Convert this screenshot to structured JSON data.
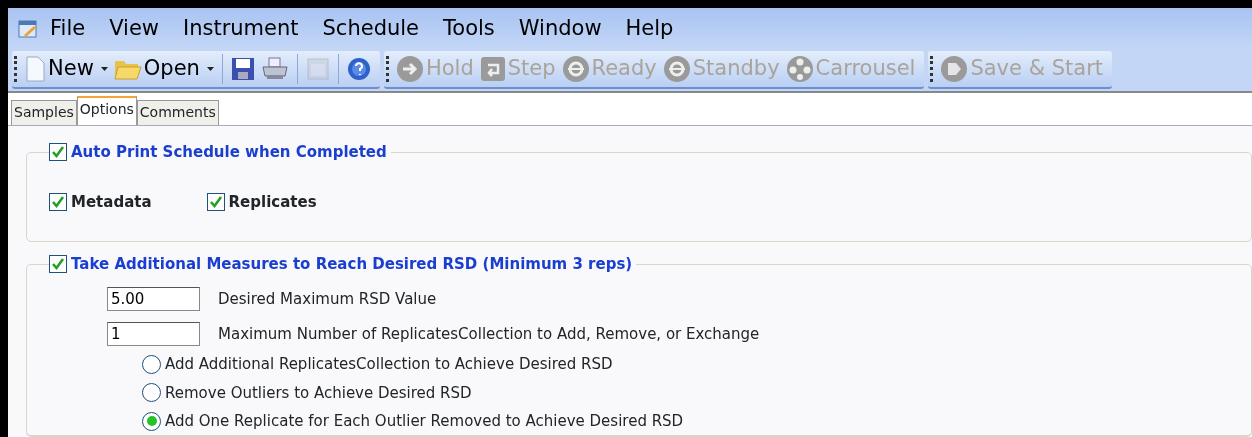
{
  "menu": [
    {
      "label": "File"
    },
    {
      "label": "View"
    },
    {
      "label": "Instrument"
    },
    {
      "label": "Schedule"
    },
    {
      "label": "Tools"
    },
    {
      "label": "Window"
    },
    {
      "label": "Help"
    }
  ],
  "toolbar": [
    {
      "items": [
        {
          "kind": "new",
          "label": "New",
          "dropdown": true,
          "disabled": false
        },
        {
          "kind": "open",
          "label": "Open",
          "dropdown": true,
          "disabled": false
        },
        {
          "kind": "separator"
        },
        {
          "kind": "save",
          "disabled": false
        },
        {
          "kind": "print",
          "disabled": false
        },
        {
          "kind": "separator"
        },
        {
          "kind": "window",
          "disabled": true
        },
        {
          "kind": "separator"
        },
        {
          "kind": "help",
          "disabled": false
        }
      ]
    },
    {
      "items": [
        {
          "kind": "hold",
          "label": "Hold",
          "disabled": true
        },
        {
          "kind": "step",
          "label": "Step",
          "disabled": true
        },
        {
          "kind": "ready",
          "label": "Ready",
          "disabled": true
        },
        {
          "kind": "standby",
          "label": "Standby",
          "disabled": true
        },
        {
          "kind": "carrousel",
          "label": "Carrousel",
          "disabled": true
        }
      ]
    },
    {
      "items": [
        {
          "kind": "start",
          "label": "Save & Start",
          "disabled": true
        }
      ]
    }
  ],
  "tabs": [
    {
      "label": "Samples",
      "selected": false
    },
    {
      "label": "Options",
      "selected": true
    },
    {
      "label": "Comments",
      "selected": false
    }
  ],
  "auto_print": {
    "label": "Auto Print Schedule when Completed",
    "checked": true,
    "options": [
      {
        "label": "Metadata",
        "checked": true
      },
      {
        "label": "Replicates",
        "checked": true
      }
    ]
  },
  "additional_measures": {
    "label": "Take Additional Measures to Reach Desired RSD (Minimum 3 reps)",
    "checked": true,
    "fields": [
      {
        "value": "5.00",
        "label": "Desired Maximum RSD Value"
      },
      {
        "value": "1",
        "label": "Maximum Number of ReplicatesCollection to Add, Remove, or Exchange"
      }
    ],
    "choices": [
      {
        "label": "Add Additional ReplicatesCollection to Achieve Desired RSD",
        "selected": false
      },
      {
        "label": "Remove Outliers to Achieve Desired RSD",
        "selected": false
      },
      {
        "label": "Add One Replicate for Each Outlier Removed to Achieve Desired RSD",
        "selected": true
      }
    ]
  }
}
